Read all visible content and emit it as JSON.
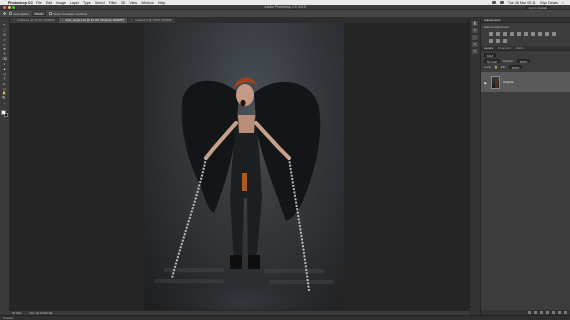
{
  "menubar": {
    "apple": "",
    "app_name": "Photoshop CC",
    "items": [
      "File",
      "Edit",
      "Image",
      "Layer",
      "Type",
      "Select",
      "Filter",
      "3D",
      "View",
      "Window",
      "Help"
    ],
    "clock": "Tue 28 Mar 00:11",
    "user": "Glyn Dewis"
  },
  "window": {
    "title": "Adobe Photoshop CC 2015",
    "workspace": "Glyn's Default"
  },
  "options": {
    "tool_button": "Auto-Select",
    "group_select": "Group",
    "show_transform_label": "Show Transform Controls"
  },
  "tabs": [
    {
      "label": "Untitled-1 @ 33.3% (RGB/8)",
      "active": false
    },
    {
      "label": "dark_angel.psd @ 33.3% (Original, RGB/8*)",
      "active": true
    },
    {
      "label": "Untitled-2 @ 100% (RGB/8)",
      "active": false
    }
  ],
  "tools": [
    "↖",
    "⬚",
    "ʘ",
    "⌗",
    "✂",
    "⊕",
    "✎",
    "⌫",
    "◐",
    "▲",
    "◇",
    "T",
    "▸",
    "▭",
    "✋",
    "🔍",
    "…"
  ],
  "status": {
    "zoom": "33.33%",
    "doc": "Doc: 60.1M/60.1M"
  },
  "timeline": "Timeline",
  "panels": {
    "adjustments_tab": "Adjustments",
    "adjustments_sub": "Add an adjustment",
    "layers_tab": "Layers",
    "channels_tab": "Channels",
    "paths_tab": "Paths",
    "kind": "Kind",
    "blend": "Normal",
    "opacity_label": "Opacity:",
    "opacity": "100%",
    "lock_label": "Lock:",
    "fill_label": "Fill:",
    "fill": "100%",
    "layer_name": "Original"
  },
  "colors": {
    "menubar_bg": "#e9e9e9",
    "ui_bg": "#262626",
    "panel_bg": "#3c3c3c",
    "traffic_close": "#fc5f57",
    "traffic_min": "#fdbc2e",
    "traffic_max": "#2bc840"
  }
}
